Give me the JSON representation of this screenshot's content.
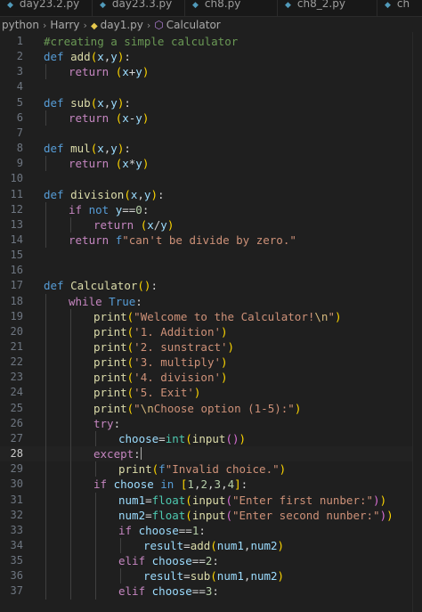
{
  "tabs": [
    {
      "label": "day23.2.py"
    },
    {
      "label": "day23.3.py"
    },
    {
      "label": "ch8.py"
    },
    {
      "label": "ch8_2.py"
    },
    {
      "label": "ch"
    }
  ],
  "breadcrumb": {
    "items": [
      "python",
      "Harry",
      "day1.py",
      "Calculator"
    ]
  },
  "editor": {
    "language": "python",
    "current_line": 28,
    "lines": [
      {
        "n": 1,
        "indent": 0,
        "tokens": [
          {
            "t": "#creating a simple calculator",
            "c": "com"
          }
        ]
      },
      {
        "n": 2,
        "indent": 0,
        "tokens": [
          {
            "t": "def",
            "c": "kw"
          },
          {
            "t": " "
          },
          {
            "t": "add",
            "c": "fn"
          },
          {
            "t": "(",
            "c": "br1"
          },
          {
            "t": "x",
            "c": "var"
          },
          {
            "t": ","
          },
          {
            "t": "y",
            "c": "var"
          },
          {
            "t": ")",
            "c": "br1"
          },
          {
            "t": ":"
          }
        ]
      },
      {
        "n": 3,
        "indent": 1,
        "tokens": [
          {
            "t": "return",
            "c": "ctl"
          },
          {
            "t": " "
          },
          {
            "t": "(",
            "c": "br1"
          },
          {
            "t": "x",
            "c": "var"
          },
          {
            "t": "+",
            "c": "op"
          },
          {
            "t": "y",
            "c": "var"
          },
          {
            "t": ")",
            "c": "br1"
          }
        ]
      },
      {
        "n": 4,
        "indent": 0,
        "tokens": []
      },
      {
        "n": 5,
        "indent": 0,
        "tokens": [
          {
            "t": "def",
            "c": "kw"
          },
          {
            "t": " "
          },
          {
            "t": "sub",
            "c": "fn"
          },
          {
            "t": "(",
            "c": "br1"
          },
          {
            "t": "x",
            "c": "var"
          },
          {
            "t": ","
          },
          {
            "t": "y",
            "c": "var"
          },
          {
            "t": ")",
            "c": "br1"
          },
          {
            "t": ":"
          }
        ]
      },
      {
        "n": 6,
        "indent": 1,
        "tokens": [
          {
            "t": "return",
            "c": "ctl"
          },
          {
            "t": " "
          },
          {
            "t": "(",
            "c": "br1"
          },
          {
            "t": "x",
            "c": "var"
          },
          {
            "t": "-",
            "c": "op"
          },
          {
            "t": "y",
            "c": "var"
          },
          {
            "t": ")",
            "c": "br1"
          }
        ]
      },
      {
        "n": 7,
        "indent": 0,
        "tokens": []
      },
      {
        "n": 8,
        "indent": 0,
        "tokens": [
          {
            "t": "def",
            "c": "kw"
          },
          {
            "t": " "
          },
          {
            "t": "mul",
            "c": "fn"
          },
          {
            "t": "(",
            "c": "br1"
          },
          {
            "t": "x",
            "c": "var"
          },
          {
            "t": ","
          },
          {
            "t": "y",
            "c": "var"
          },
          {
            "t": ")",
            "c": "br1"
          },
          {
            "t": ":"
          }
        ]
      },
      {
        "n": 9,
        "indent": 1,
        "tokens": [
          {
            "t": "return",
            "c": "ctl"
          },
          {
            "t": " "
          },
          {
            "t": "(",
            "c": "br1"
          },
          {
            "t": "x",
            "c": "var"
          },
          {
            "t": "*",
            "c": "op"
          },
          {
            "t": "y",
            "c": "var"
          },
          {
            "t": ")",
            "c": "br1"
          }
        ]
      },
      {
        "n": 10,
        "indent": 0,
        "tokens": []
      },
      {
        "n": 11,
        "indent": 0,
        "tokens": [
          {
            "t": "def",
            "c": "kw"
          },
          {
            "t": " "
          },
          {
            "t": "division",
            "c": "fn"
          },
          {
            "t": "(",
            "c": "br1"
          },
          {
            "t": "x",
            "c": "var"
          },
          {
            "t": ","
          },
          {
            "t": "y",
            "c": "var"
          },
          {
            "t": ")",
            "c": "br1"
          },
          {
            "t": ":"
          }
        ]
      },
      {
        "n": 12,
        "indent": 1,
        "tokens": [
          {
            "t": "if",
            "c": "ctl"
          },
          {
            "t": " "
          },
          {
            "t": "not",
            "c": "kw"
          },
          {
            "t": " "
          },
          {
            "t": "y",
            "c": "var"
          },
          {
            "t": "=="
          },
          {
            "t": "0",
            "c": "num"
          },
          {
            "t": ":"
          }
        ]
      },
      {
        "n": 13,
        "indent": 2,
        "tokens": [
          {
            "t": "return",
            "c": "ctl"
          },
          {
            "t": " "
          },
          {
            "t": "(",
            "c": "br1"
          },
          {
            "t": "x",
            "c": "var"
          },
          {
            "t": "/",
            "c": "op"
          },
          {
            "t": "y",
            "c": "var"
          },
          {
            "t": ")",
            "c": "br1"
          }
        ]
      },
      {
        "n": 14,
        "indent": 1,
        "tokens": [
          {
            "t": "return",
            "c": "ctl"
          },
          {
            "t": " "
          },
          {
            "t": "f",
            "c": "kw"
          },
          {
            "t": "\"can't be divide by zero.\"",
            "c": "str"
          }
        ]
      },
      {
        "n": 15,
        "indent": 0,
        "tokens": []
      },
      {
        "n": 16,
        "indent": 0,
        "tokens": []
      },
      {
        "n": 17,
        "indent": 0,
        "tokens": [
          {
            "t": "def",
            "c": "kw"
          },
          {
            "t": " "
          },
          {
            "t": "Calculator",
            "c": "fn"
          },
          {
            "t": "(",
            "c": "br1"
          },
          {
            "t": ")",
            "c": "br1"
          },
          {
            "t": ":"
          }
        ]
      },
      {
        "n": 18,
        "indent": 1,
        "tokens": [
          {
            "t": "while",
            "c": "ctl"
          },
          {
            "t": " "
          },
          {
            "t": "True",
            "c": "kw"
          },
          {
            "t": ":"
          }
        ]
      },
      {
        "n": 19,
        "indent": 2,
        "tokens": [
          {
            "t": "print",
            "c": "fn"
          },
          {
            "t": "(",
            "c": "br1"
          },
          {
            "t": "\"Welcome to the Calculator!",
            "c": "str"
          },
          {
            "t": "\\n",
            "c": "esc"
          },
          {
            "t": "\"",
            "c": "str"
          },
          {
            "t": ")",
            "c": "br1"
          }
        ]
      },
      {
        "n": 20,
        "indent": 2,
        "tokens": [
          {
            "t": "print",
            "c": "fn"
          },
          {
            "t": "(",
            "c": "br1"
          },
          {
            "t": "'1. Addition'",
            "c": "str"
          },
          {
            "t": ")",
            "c": "br1"
          }
        ]
      },
      {
        "n": 21,
        "indent": 2,
        "tokens": [
          {
            "t": "print",
            "c": "fn"
          },
          {
            "t": "(",
            "c": "br1"
          },
          {
            "t": "'2. sunstract'",
            "c": "str"
          },
          {
            "t": ")",
            "c": "br1"
          }
        ]
      },
      {
        "n": 22,
        "indent": 2,
        "tokens": [
          {
            "t": "print",
            "c": "fn"
          },
          {
            "t": "(",
            "c": "br1"
          },
          {
            "t": "'3. multiply'",
            "c": "str"
          },
          {
            "t": ")",
            "c": "br1"
          }
        ]
      },
      {
        "n": 23,
        "indent": 2,
        "tokens": [
          {
            "t": "print",
            "c": "fn"
          },
          {
            "t": "(",
            "c": "br1"
          },
          {
            "t": "'4. division'",
            "c": "str"
          },
          {
            "t": ")",
            "c": "br1"
          }
        ]
      },
      {
        "n": 24,
        "indent": 2,
        "tokens": [
          {
            "t": "print",
            "c": "fn"
          },
          {
            "t": "(",
            "c": "br1"
          },
          {
            "t": "'5. Exit'",
            "c": "str"
          },
          {
            "t": ")",
            "c": "br1"
          }
        ]
      },
      {
        "n": 25,
        "indent": 2,
        "tokens": [
          {
            "t": "print",
            "c": "fn"
          },
          {
            "t": "(",
            "c": "br1"
          },
          {
            "t": "\"",
            "c": "str"
          },
          {
            "t": "\\n",
            "c": "esc"
          },
          {
            "t": "Choose option (1-5):\"",
            "c": "str"
          },
          {
            "t": ")",
            "c": "br1"
          }
        ]
      },
      {
        "n": 26,
        "indent": 2,
        "tokens": [
          {
            "t": "try",
            "c": "ctl"
          },
          {
            "t": ":"
          }
        ]
      },
      {
        "n": 27,
        "indent": 3,
        "tokens": [
          {
            "t": "choose",
            "c": "var"
          },
          {
            "t": "="
          },
          {
            "t": "int",
            "c": "cls"
          },
          {
            "t": "(",
            "c": "br1"
          },
          {
            "t": "input",
            "c": "fn"
          },
          {
            "t": "(",
            "c": "br2"
          },
          {
            "t": ")",
            "c": "br2"
          },
          {
            "t": ")",
            "c": "br1"
          }
        ]
      },
      {
        "n": 28,
        "indent": 2,
        "tokens": [
          {
            "t": "except",
            "c": "ctl"
          },
          {
            "t": ":"
          }
        ],
        "caret": true
      },
      {
        "n": 29,
        "indent": 3,
        "tokens": [
          {
            "t": "print",
            "c": "fn"
          },
          {
            "t": "(",
            "c": "br1"
          },
          {
            "t": "f",
            "c": "kw"
          },
          {
            "t": "\"Invalid choice.\"",
            "c": "str"
          },
          {
            "t": ")",
            "c": "br1"
          }
        ]
      },
      {
        "n": 30,
        "indent": 2,
        "tokens": [
          {
            "t": "if",
            "c": "ctl"
          },
          {
            "t": " "
          },
          {
            "t": "choose",
            "c": "var"
          },
          {
            "t": " "
          },
          {
            "t": "in",
            "c": "kw"
          },
          {
            "t": " "
          },
          {
            "t": "[",
            "c": "br1"
          },
          {
            "t": "1",
            "c": "num"
          },
          {
            "t": ","
          },
          {
            "t": "2",
            "c": "num"
          },
          {
            "t": ","
          },
          {
            "t": "3",
            "c": "num"
          },
          {
            "t": ","
          },
          {
            "t": "4",
            "c": "num"
          },
          {
            "t": "]",
            "c": "br1"
          },
          {
            "t": ":"
          }
        ]
      },
      {
        "n": 31,
        "indent": 3,
        "tokens": [
          {
            "t": "num1",
            "c": "var"
          },
          {
            "t": "="
          },
          {
            "t": "float",
            "c": "cls"
          },
          {
            "t": "(",
            "c": "br1"
          },
          {
            "t": "input",
            "c": "fn"
          },
          {
            "t": "(",
            "c": "br2"
          },
          {
            "t": "\"Enter first nunber:\"",
            "c": "str"
          },
          {
            "t": ")",
            "c": "br2"
          },
          {
            "t": ")",
            "c": "br1"
          }
        ]
      },
      {
        "n": 32,
        "indent": 3,
        "tokens": [
          {
            "t": "num2",
            "c": "var"
          },
          {
            "t": "="
          },
          {
            "t": "float",
            "c": "cls"
          },
          {
            "t": "(",
            "c": "br1"
          },
          {
            "t": "input",
            "c": "fn"
          },
          {
            "t": "(",
            "c": "br2"
          },
          {
            "t": "\"Enter second nunber:\"",
            "c": "str"
          },
          {
            "t": ")",
            "c": "br2"
          },
          {
            "t": ")",
            "c": "br1"
          }
        ]
      },
      {
        "n": 33,
        "indent": 3,
        "tokens": [
          {
            "t": "if",
            "c": "ctl"
          },
          {
            "t": " "
          },
          {
            "t": "choose",
            "c": "var"
          },
          {
            "t": "=="
          },
          {
            "t": "1",
            "c": "num"
          },
          {
            "t": ":"
          }
        ]
      },
      {
        "n": 34,
        "indent": 4,
        "tokens": [
          {
            "t": "result",
            "c": "var"
          },
          {
            "t": "="
          },
          {
            "t": "add",
            "c": "fn"
          },
          {
            "t": "(",
            "c": "br1"
          },
          {
            "t": "num1",
            "c": "var"
          },
          {
            "t": ","
          },
          {
            "t": "num2",
            "c": "var"
          },
          {
            "t": ")",
            "c": "br1"
          }
        ]
      },
      {
        "n": 35,
        "indent": 3,
        "tokens": [
          {
            "t": "elif",
            "c": "ctl"
          },
          {
            "t": " "
          },
          {
            "t": "choose",
            "c": "var"
          },
          {
            "t": "=="
          },
          {
            "t": "2",
            "c": "num"
          },
          {
            "t": ":"
          }
        ]
      },
      {
        "n": 36,
        "indent": 4,
        "tokens": [
          {
            "t": "result",
            "c": "var"
          },
          {
            "t": "="
          },
          {
            "t": "sub",
            "c": "fn"
          },
          {
            "t": "(",
            "c": "br1"
          },
          {
            "t": "num1",
            "c": "var"
          },
          {
            "t": ","
          },
          {
            "t": "num2",
            "c": "var"
          },
          {
            "t": ")",
            "c": "br1"
          }
        ]
      },
      {
        "n": 37,
        "indent": 3,
        "tokens": [
          {
            "t": "elif",
            "c": "ctl"
          },
          {
            "t": " "
          },
          {
            "t": "choose",
            "c": "var"
          },
          {
            "t": "=="
          },
          {
            "t": "3",
            "c": "num"
          },
          {
            "t": ":"
          }
        ]
      }
    ]
  }
}
